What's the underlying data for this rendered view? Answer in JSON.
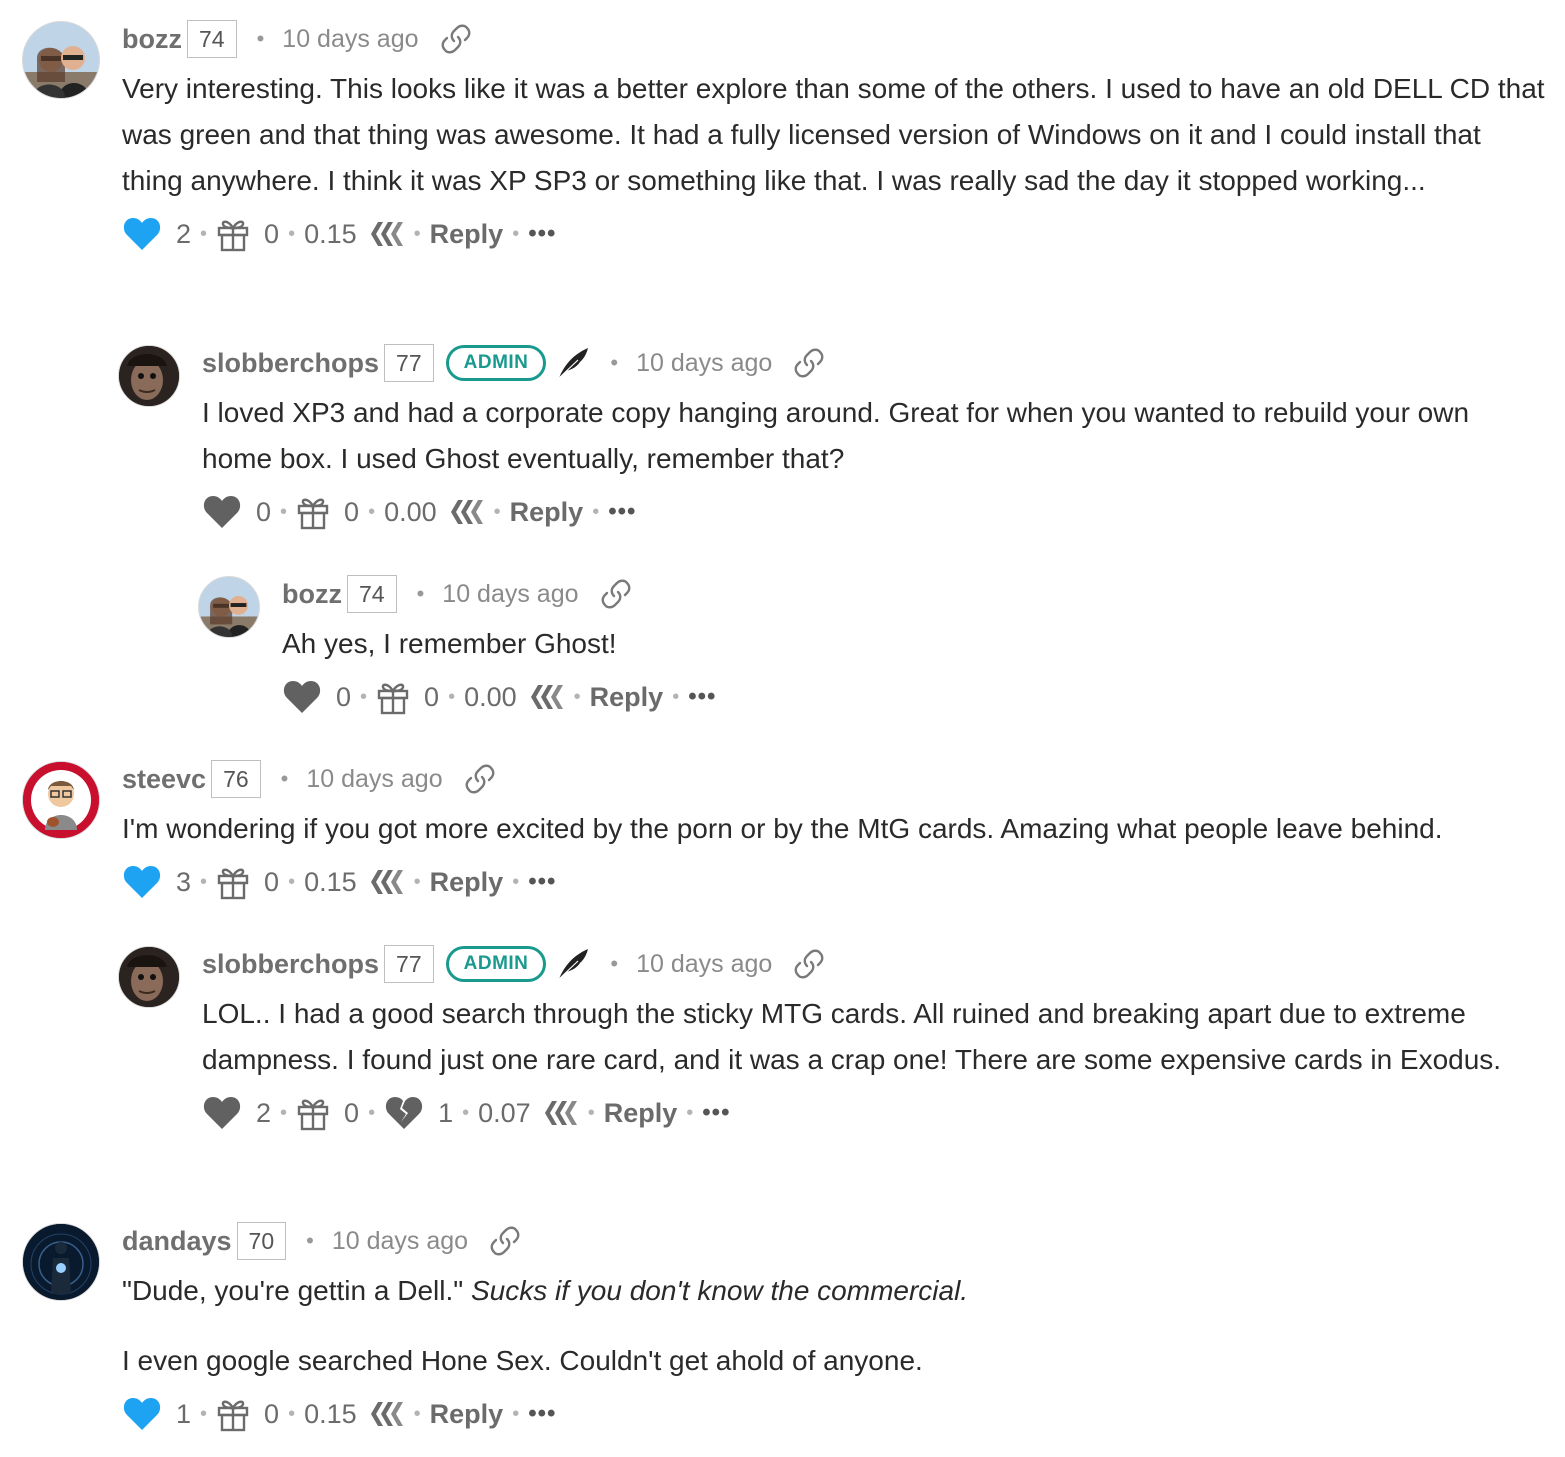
{
  "comments": [
    {
      "author": "bozz",
      "reputation": "74",
      "time": "10 days ago",
      "paragraphs": [
        "Very interesting. This looks like it was a better explore than some of the others. I used to have an old DELL CD that was green and that thing was awesome. It had a fully licensed version of Windows on it and I could install that thing anywhere. I think it was XP SP3 or something like that. I was really sad the day it stopped working..."
      ],
      "votes": "2",
      "gifts": "0",
      "payout": "0.15",
      "reply_label": "Reply",
      "more_label": "•••"
    },
    {
      "author": "slobberchops",
      "reputation": "77",
      "badge": "ADMIN",
      "time": "10 days ago",
      "paragraphs": [
        "I loved XP3 and had a corporate copy hanging around. Great for when you wanted to rebuild your own home box. I used Ghost eventually, remember that?"
      ],
      "votes": "0",
      "gifts": "0",
      "payout": "0.00",
      "reply_label": "Reply",
      "more_label": "•••"
    },
    {
      "author": "bozz",
      "reputation": "74",
      "time": "10 days ago",
      "paragraphs": [
        "Ah yes, I remember Ghost!"
      ],
      "votes": "0",
      "gifts": "0",
      "payout": "0.00",
      "reply_label": "Reply",
      "more_label": "•••"
    },
    {
      "author": "steevc",
      "reputation": "76",
      "time": "10 days ago",
      "paragraphs": [
        "I'm wondering if you got more excited by the porn or by the MtG cards. Amazing what people leave behind."
      ],
      "votes": "3",
      "gifts": "0",
      "payout": "0.15",
      "reply_label": "Reply",
      "more_label": "•••"
    },
    {
      "author": "slobberchops",
      "reputation": "77",
      "badge": "ADMIN",
      "time": "10 days ago",
      "paragraphs": [
        "LOL.. I had a good search through the sticky MTG cards. All ruined and breaking apart due to extreme dampness. I found just one rare card, and it was a crap one! There are some expensive cards in Exodus."
      ],
      "votes": "2",
      "gifts": "0",
      "downvotes": "1",
      "payout": "0.07",
      "reply_label": "Reply",
      "more_label": "•••"
    },
    {
      "author": "dandays",
      "reputation": "70",
      "time": "10 days ago",
      "paragraph1_plain": "\"Dude, you're gettin a Dell.\" ",
      "paragraph1_italic": "Sucks if you don't know the commercial.",
      "paragraph2": "I even google searched Hone Sex. Couldn't get ahold of anyone.",
      "votes": "1",
      "gifts": "0",
      "payout": "0.15",
      "reply_label": "Reply",
      "more_label": "•••"
    }
  ],
  "colors": {
    "voted_heart": "#1ea3f2",
    "unvoted_heart": "#616161",
    "admin_badge": "#1a9a8e"
  }
}
